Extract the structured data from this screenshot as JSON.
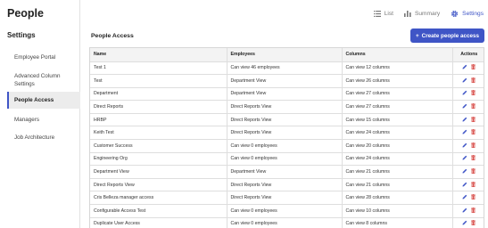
{
  "app": {
    "title": "People"
  },
  "top_nav": {
    "items": [
      {
        "label": "List",
        "icon": "list-icon",
        "active": false
      },
      {
        "label": "Summary",
        "icon": "bar-chart-icon",
        "active": false
      },
      {
        "label": "Settings",
        "icon": "gear-icon",
        "active": true
      }
    ]
  },
  "sidebar": {
    "title": "Settings",
    "items": [
      {
        "label": "Employee Portal",
        "active": false
      },
      {
        "label": "Advanced Column Settings",
        "active": false
      },
      {
        "label": "People Access",
        "active": true
      },
      {
        "label": "Managers",
        "active": false
      },
      {
        "label": "Job Architecture",
        "active": false
      }
    ]
  },
  "main": {
    "title": "People Access",
    "create_button": {
      "label": "Create people access",
      "icon": "plus-icon"
    }
  },
  "table": {
    "columns": [
      "Name",
      "Employees",
      "Columns",
      "Actions"
    ],
    "rows": [
      {
        "name": "Test 1",
        "employees": "Can view 46 employees",
        "columns": "Can view 12 columns"
      },
      {
        "name": "Test",
        "employees": "Department View",
        "columns": "Can view 26 columns"
      },
      {
        "name": "Department",
        "employees": "Department View",
        "columns": "Can view 27 columns"
      },
      {
        "name": "Direct Reports",
        "employees": "Direct Reports View",
        "columns": "Can view 27 columns"
      },
      {
        "name": "HRBP",
        "employees": "Direct Reports View",
        "columns": "Can view 15 columns"
      },
      {
        "name": "Keith Test",
        "employees": "Direct Reports View",
        "columns": "Can view 24 columns"
      },
      {
        "name": "Customer Success",
        "employees": "Can view 0 employees",
        "columns": "Can view 20 columns"
      },
      {
        "name": "Engineering Org",
        "employees": "Can view 0 employees",
        "columns": "Can view 24 columns"
      },
      {
        "name": "Department View",
        "employees": "Department View",
        "columns": "Can view 21 columns"
      },
      {
        "name": "Direct Reports View",
        "employees": "Direct Reports View",
        "columns": "Can view 21 columns"
      },
      {
        "name": "Cris Belleza manager access",
        "employees": "Direct Reports View",
        "columns": "Can view 28 columns"
      },
      {
        "name": "Configurable Access Test",
        "employees": "Can view 0 employees",
        "columns": "Can view 10 columns"
      },
      {
        "name": "Duplicate User Access",
        "employees": "Can view 0 employees",
        "columns": "Can view 8 columns"
      }
    ],
    "row_actions": {
      "edit_icon": "pencil-icon",
      "delete_icon": "trash-icon"
    }
  },
  "colors": {
    "accent": "#3f55c6",
    "delete": "#d9534f"
  }
}
